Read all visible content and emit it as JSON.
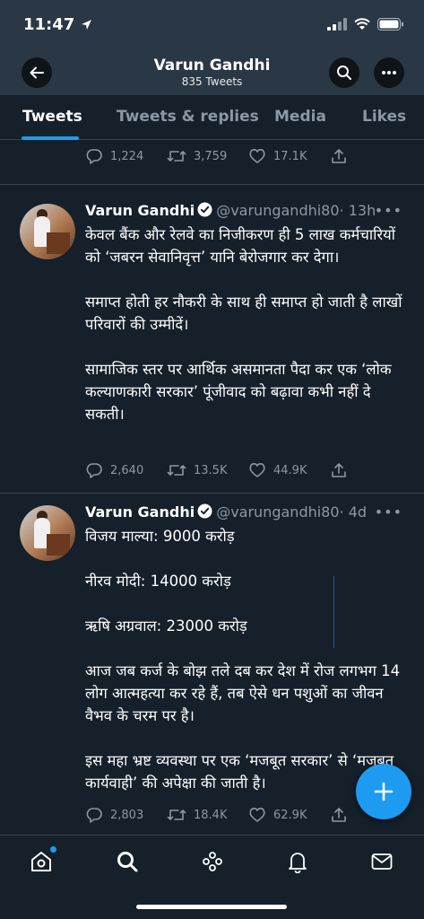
{
  "status_bar": {
    "time": "11:47"
  },
  "header": {
    "title": "Varun Gandhi",
    "subtitle": "835 Tweets"
  },
  "tabs": [
    {
      "label": "Tweets",
      "active": true
    },
    {
      "label": "Tweets & replies",
      "active": false
    },
    {
      "label": "Media",
      "active": false
    },
    {
      "label": "Likes",
      "active": false
    }
  ],
  "top_actions": {
    "replies": "1,224",
    "retweets": "3,759",
    "likes": "17.1K"
  },
  "tweets": [
    {
      "name": "Varun Gandhi",
      "handle": "@varungandhi80",
      "time": "· 13h",
      "paragraphs": [
        "केवल बैंक और रेलवे का निजीकरण ही 5 लाख कर्मचारियों को ‘जबरन सेवानिवृत्त’ यानि बेरोजगार कर देगा।",
        "समाप्त होती हर नौकरी के साथ ही समाप्त हो जाती है लाखों परिवारों की उम्मीदें।",
        "सामाजिक स्तर पर आर्थिक असमानता पैदा कर एक ‘लोक कल्याणकारी सरकार’ पूंजीवाद को बढ़ावा कभी नहीं दे सकती।"
      ],
      "replies": "2,640",
      "retweets": "13.5K",
      "likes": "44.9K"
    },
    {
      "name": "Varun Gandhi",
      "handle": "@varungandhi80",
      "time": "· 4d",
      "paragraphs": [
        "विजय माल्या: 9000 करोड़",
        "नीरव मोदी: 14000 करोड़",
        "ऋषि अग्रवाल: 23000 करोड़",
        "आज जब कर्ज के बोझ तले दब कर देश में रोज लगभग 14 लोग आत्महत्या कर रहे हैं, तब ऐसे धन पशुओं का जीवन वैभव के चरम पर है।",
        "इस महा भ्रष्ट व्यवस्था पर एक ‘मजबूत सरकार’ से ‘मजबूत कार्यवाही’ की अपेक्षा की जाती है।"
      ],
      "replies": "2,803",
      "retweets": "18.4K",
      "likes": "62.9K"
    }
  ],
  "icons": {
    "back": "arrow-left-icon",
    "search": "search-icon",
    "more": "more-icon",
    "reply": "reply-icon",
    "retweet": "retweet-icon",
    "like": "heart-icon",
    "share": "share-icon",
    "compose": "plus-icon",
    "nav": [
      "home-icon",
      "search-icon",
      "spaces-icon",
      "notifications-icon",
      "messages-icon"
    ]
  },
  "colors": {
    "background": "#15202b",
    "accent": "#1d9bf0",
    "muted": "#8b98a5"
  }
}
